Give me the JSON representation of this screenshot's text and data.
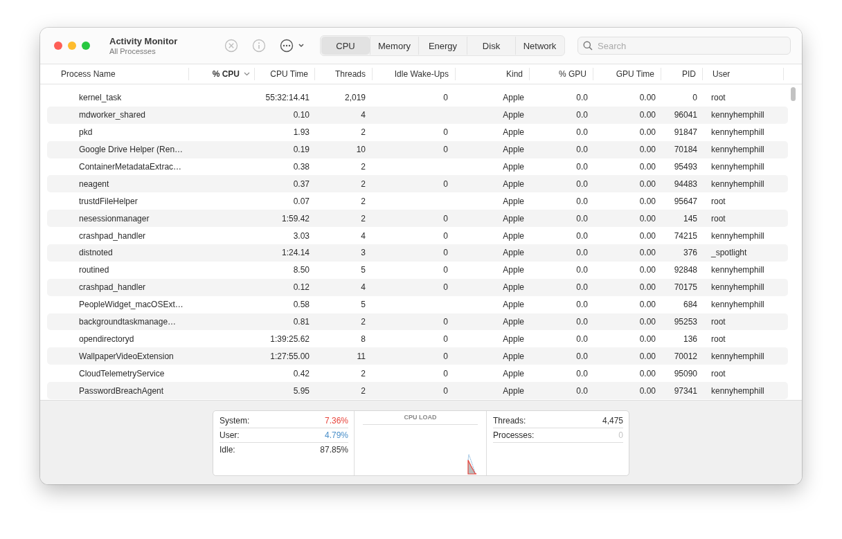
{
  "window": {
    "title": "Activity Monitor",
    "subtitle": "All Processes"
  },
  "toolbar": {
    "stop_disabled": true,
    "info_disabled": true
  },
  "tabs": [
    {
      "label": "CPU",
      "selected": true
    },
    {
      "label": "Memory",
      "selected": false
    },
    {
      "label": "Energy",
      "selected": false
    },
    {
      "label": "Disk",
      "selected": false
    },
    {
      "label": "Network",
      "selected": false
    }
  ],
  "search": {
    "placeholder": "Search"
  },
  "table": {
    "columns": [
      {
        "label": "Process Name",
        "sorted": false
      },
      {
        "label": "% CPU",
        "sorted": true
      },
      {
        "label": "CPU Time",
        "sorted": false
      },
      {
        "label": "Threads",
        "sorted": false
      },
      {
        "label": "Idle Wake-Ups",
        "sorted": false
      },
      {
        "label": "Kind",
        "sorted": false
      },
      {
        "label": "% GPU",
        "sorted": false
      },
      {
        "label": "GPU Time",
        "sorted": false
      },
      {
        "label": "PID",
        "sorted": false
      },
      {
        "label": "User",
        "sorted": false
      }
    ],
    "rows": [
      [
        "kernel_task",
        "",
        "55:32:14.41",
        "2,019",
        "0",
        "Apple",
        "0.0",
        "0.00",
        "0",
        "root"
      ],
      [
        "mdworker_shared",
        "",
        "0.10",
        "4",
        "",
        "Apple",
        "0.0",
        "0.00",
        "96041",
        "kennyhemphill"
      ],
      [
        "pkd",
        "",
        "1.93",
        "2",
        "0",
        "Apple",
        "0.0",
        "0.00",
        "91847",
        "kennyhemphill"
      ],
      [
        "Google Drive Helper (Ren…",
        "",
        "0.19",
        "10",
        "0",
        "Apple",
        "0.0",
        "0.00",
        "70184",
        "kennyhemphill"
      ],
      [
        "ContainerMetadataExtrac…",
        "",
        "0.38",
        "2",
        "",
        "Apple",
        "0.0",
        "0.00",
        "95493",
        "kennyhemphill"
      ],
      [
        "neagent",
        "",
        "0.37",
        "2",
        "0",
        "Apple",
        "0.0",
        "0.00",
        "94483",
        "kennyhemphill"
      ],
      [
        "trustdFileHelper",
        "",
        "0.07",
        "2",
        "",
        "Apple",
        "0.0",
        "0.00",
        "95647",
        "root"
      ],
      [
        "nesessionmanager",
        "",
        "1:59.42",
        "2",
        "0",
        "Apple",
        "0.0",
        "0.00",
        "145",
        "root"
      ],
      [
        "crashpad_handler",
        "",
        "3.03",
        "4",
        "0",
        "Apple",
        "0.0",
        "0.00",
        "74215",
        "kennyhemphill"
      ],
      [
        "distnoted",
        "",
        "1:24.14",
        "3",
        "0",
        "Apple",
        "0.0",
        "0.00",
        "376",
        "_spotlight"
      ],
      [
        "routined",
        "",
        "8.50",
        "5",
        "0",
        "Apple",
        "0.0",
        "0.00",
        "92848",
        "kennyhemphill"
      ],
      [
        "crashpad_handler",
        "",
        "0.12",
        "4",
        "0",
        "Apple",
        "0.0",
        "0.00",
        "70175",
        "kennyhemphill"
      ],
      [
        "PeopleWidget_macOSExt…",
        "",
        "0.58",
        "5",
        "",
        "Apple",
        "0.0",
        "0.00",
        "684",
        "kennyhemphill"
      ],
      [
        "backgroundtaskmanage…",
        "",
        "0.81",
        "2",
        "0",
        "Apple",
        "0.0",
        "0.00",
        "95253",
        "root"
      ],
      [
        "opendirectoryd",
        "",
        "1:39:25.62",
        "8",
        "0",
        "Apple",
        "0.0",
        "0.00",
        "136",
        "root"
      ],
      [
        "WallpaperVideoExtension",
        "",
        "1:27:55.00",
        "11",
        "0",
        "Apple",
        "0.0",
        "0.00",
        "70012",
        "kennyhemphill"
      ],
      [
        "CloudTelemetryService",
        "",
        "0.42",
        "2",
        "0",
        "Apple",
        "0.0",
        "0.00",
        "95090",
        "root"
      ],
      [
        "PasswordBreachAgent",
        "",
        "5.95",
        "2",
        "0",
        "Apple",
        "0.0",
        "0.00",
        "97341",
        "kennyhemphill"
      ]
    ]
  },
  "summary": {
    "cpu_stats": [
      {
        "label": "System:",
        "value": "7.36%",
        "color": "#e8453c"
      },
      {
        "label": "User:",
        "value": "4.79%",
        "color": "#4a8fc9"
      },
      {
        "label": "Idle:",
        "value": "87.85%",
        "color": "#333333"
      }
    ],
    "chart_title": "CPU LOAD",
    "counts": [
      {
        "label": "Threads:",
        "value": "4,475",
        "color": "#333333"
      },
      {
        "label": "Processes:",
        "value": "0",
        "color": "#c4c4c4"
      }
    ]
  }
}
